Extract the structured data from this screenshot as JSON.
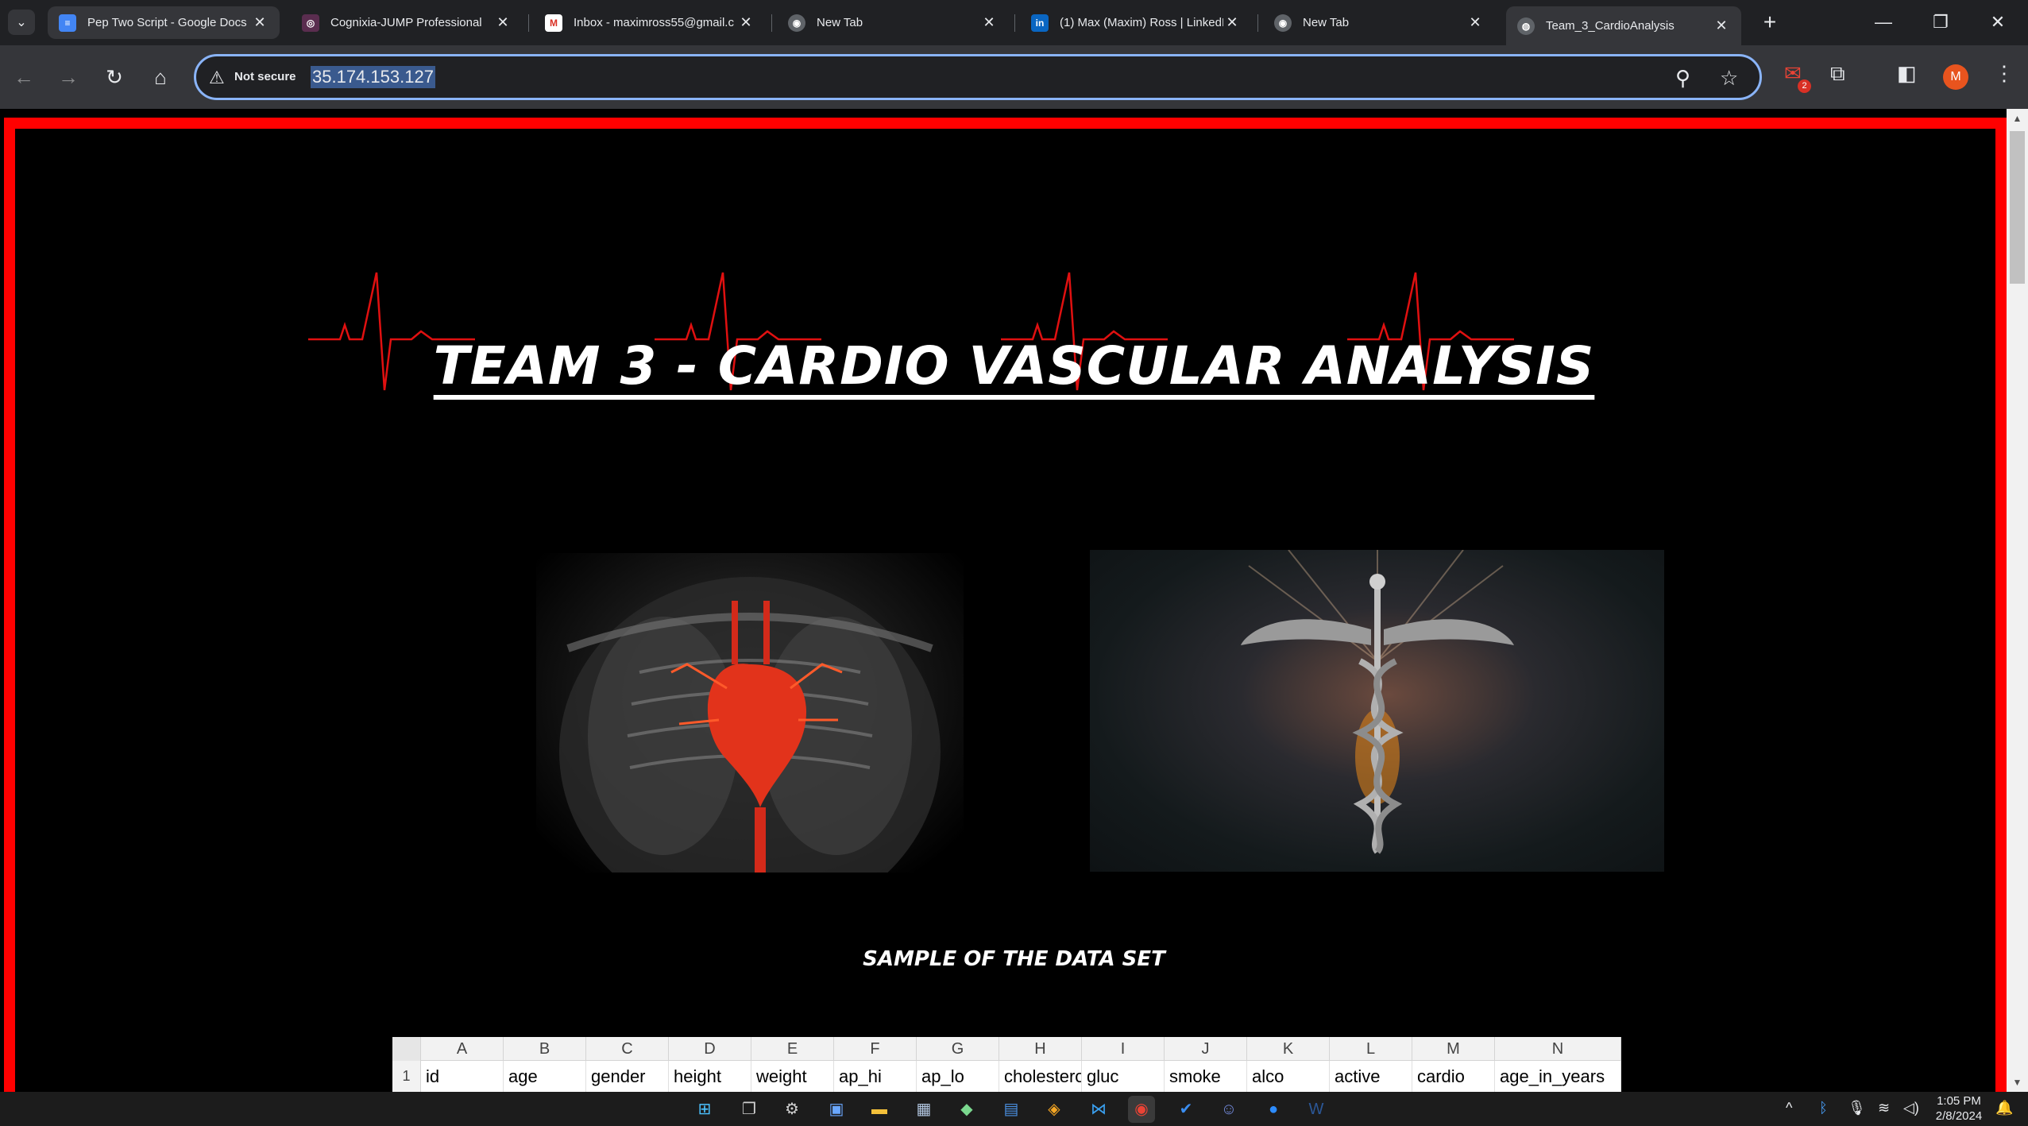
{
  "browser": {
    "tabs": [
      {
        "title": "Pep Two Script - Google Docs",
        "icon": "google-docs-icon",
        "active": false
      },
      {
        "title": "Cognixia-JUMP Professional",
        "icon": "cognixia-icon",
        "active": false
      },
      {
        "title": "Inbox - maximross55@gmail.c",
        "icon": "gmail-icon",
        "active": false
      },
      {
        "title": "New Tab",
        "icon": "chrome-icon",
        "active": false
      },
      {
        "title": "(1) Max (Maxim) Ross | LinkedI",
        "icon": "linkedin-icon",
        "active": false
      },
      {
        "title": "New Tab",
        "icon": "chrome-icon",
        "active": false
      },
      {
        "title": "Team_3_CardioAnalysis",
        "icon": "globe-icon",
        "active": true
      }
    ],
    "security_label": "Not secure",
    "url": "35.174.153.127",
    "profile_initial": "M",
    "extension_badge": "2"
  },
  "page": {
    "title": "TEAM 3 - CARDIO VASCULAR ANALYSIS",
    "subtitle": "SAMPLE OF THE DATA SET",
    "accent_color": "#ff0000",
    "images": [
      "heart-anatomy-image",
      "caduceus-image"
    ],
    "spreadsheet": {
      "columns": [
        "A",
        "B",
        "C",
        "D",
        "E",
        "F",
        "G",
        "H",
        "I",
        "J",
        "K",
        "L",
        "M",
        "N"
      ],
      "row_number": "1",
      "header_row": [
        "id",
        "age",
        "gender",
        "height",
        "weight",
        "ap_hi",
        "ap_lo",
        "cholesterol",
        "gluc",
        "smoke",
        "alco",
        "active",
        "cardio",
        "age_in_years"
      ]
    }
  },
  "taskbar": {
    "time": "1:05 PM",
    "date": "2/8/2024"
  }
}
